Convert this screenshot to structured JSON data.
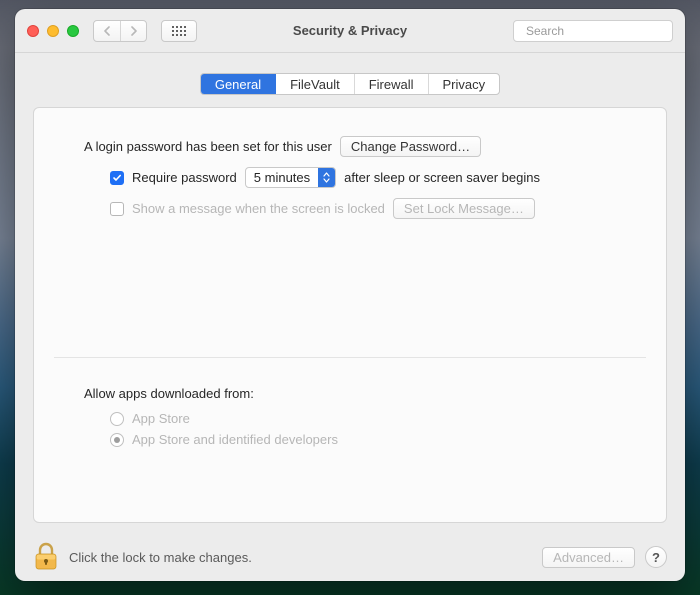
{
  "window": {
    "title": "Security & Privacy"
  },
  "search": {
    "placeholder": "Search"
  },
  "tabs": [
    {
      "label": "General",
      "active": true
    },
    {
      "label": "FileVault",
      "active": false
    },
    {
      "label": "Firewall",
      "active": false
    },
    {
      "label": "Privacy",
      "active": false
    }
  ],
  "general": {
    "login_password_text": "A login password has been set for this user",
    "change_password_button": "Change Password…",
    "require_pw_checked": true,
    "require_pw_before": "Require password",
    "require_pw_delay": "5 minutes",
    "require_pw_after": "after sleep or screen saver begins",
    "show_message_checked": false,
    "show_message_label": "Show a message when the screen is locked",
    "set_lock_message_button": "Set Lock Message…",
    "allow_apps_label": "Allow apps downloaded from:",
    "radio_options": [
      {
        "label": "App Store",
        "selected": false
      },
      {
        "label": "App Store and identified developers",
        "selected": true
      }
    ]
  },
  "footer": {
    "lock_text": "Click the lock to make changes.",
    "advanced_button": "Advanced…",
    "help_button": "?"
  }
}
